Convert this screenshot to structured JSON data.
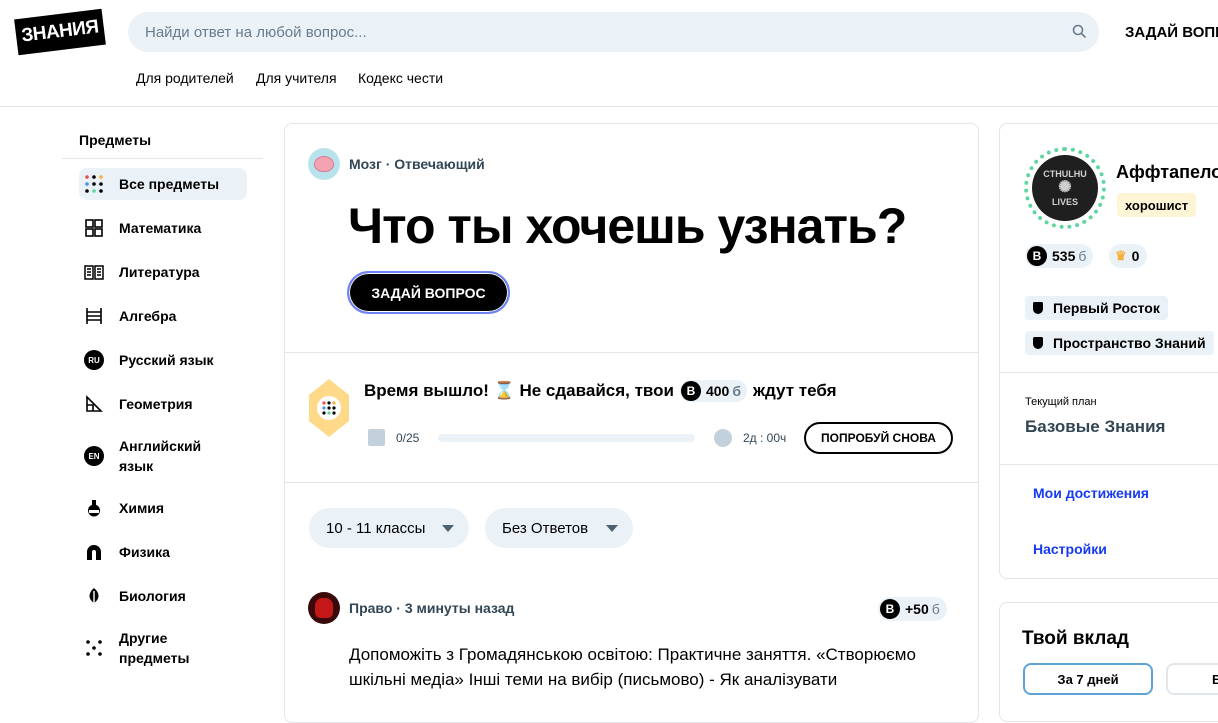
{
  "header": {
    "logo_text": "ЗНАНИЯ",
    "search_placeholder": "Найди ответ на любой вопрос...",
    "ask_button": "ЗАДАЙ ВОПРО",
    "nav": [
      "Для родителей",
      "Для учителя",
      "Кодекс чести"
    ]
  },
  "sidebar": {
    "title": "Предметы",
    "items": [
      {
        "label": "Все предметы",
        "icon": "all-subjects-icon",
        "active": true
      },
      {
        "label": "Математика",
        "icon": "math-icon"
      },
      {
        "label": "Литература",
        "icon": "literature-icon"
      },
      {
        "label": "Алгебра",
        "icon": "algebra-icon"
      },
      {
        "label": "Русский язык",
        "icon": "ru-icon",
        "badge": "RU"
      },
      {
        "label": "Геометрия",
        "icon": "geometry-icon"
      },
      {
        "label": "Английский язык",
        "icon": "en-icon",
        "badge": "EN",
        "line1": "Английский",
        "line2": "язык"
      },
      {
        "label": "Химия",
        "icon": "chemistry-icon"
      },
      {
        "label": "Физика",
        "icon": "physics-icon"
      },
      {
        "label": "Биология",
        "icon": "biology-icon"
      },
      {
        "label": "Другие предметы",
        "icon": "other-subjects-icon",
        "line1": "Другие",
        "line2": "предметы"
      }
    ]
  },
  "main": {
    "rank": "Мозг · Отвечающий",
    "hero_title": "Что ты хочешь узнать?",
    "ask_button": "ЗАДАЙ ВОПРОС",
    "challenge": {
      "text_before": "Время вышло! ⌛ Не сдавайся, твои",
      "points": "400",
      "points_unit": "б",
      "text_after": "ждут тебя",
      "progress_text": "0/25",
      "progress_fraction": 0,
      "time_left": "2д : 00ч",
      "retry_button": "ПОПРОБУЙ СНОВА"
    },
    "filters": {
      "grade": "10 - 11 классы",
      "status": "Без Ответов"
    },
    "question": {
      "meta": "Право · 3 минуты назад",
      "points": "+50",
      "points_unit": "б",
      "text": "Допоможіть з Громадянською освітою: Практичне заняття. «Створюємо шкільні медіа» Інші теми на вибір (письмово) - Як аналізувати"
    }
  },
  "profile": {
    "avatar_text": [
      "CTHULHU",
      "LIVES"
    ],
    "username": "Аффтапело",
    "rank": "хорошист",
    "points": "535",
    "points_unit": "б",
    "crowns": "0",
    "achievements": [
      "Первый Росток",
      "Пространство Знаний"
    ],
    "plan_label": "Текущий план",
    "plan_name": "Базовые Знания",
    "links": [
      "Мои достижения",
      "Настройки"
    ]
  },
  "contribution": {
    "title": "Твой вклад",
    "tab_active": "За 7 дней",
    "tab_other": "В"
  },
  "colors": {
    "accent_blue": "#163bf3",
    "light_bg": "#ebf2f7",
    "rank_badge": "#fef4d6",
    "avatar_ring": "#5fd6a0"
  }
}
